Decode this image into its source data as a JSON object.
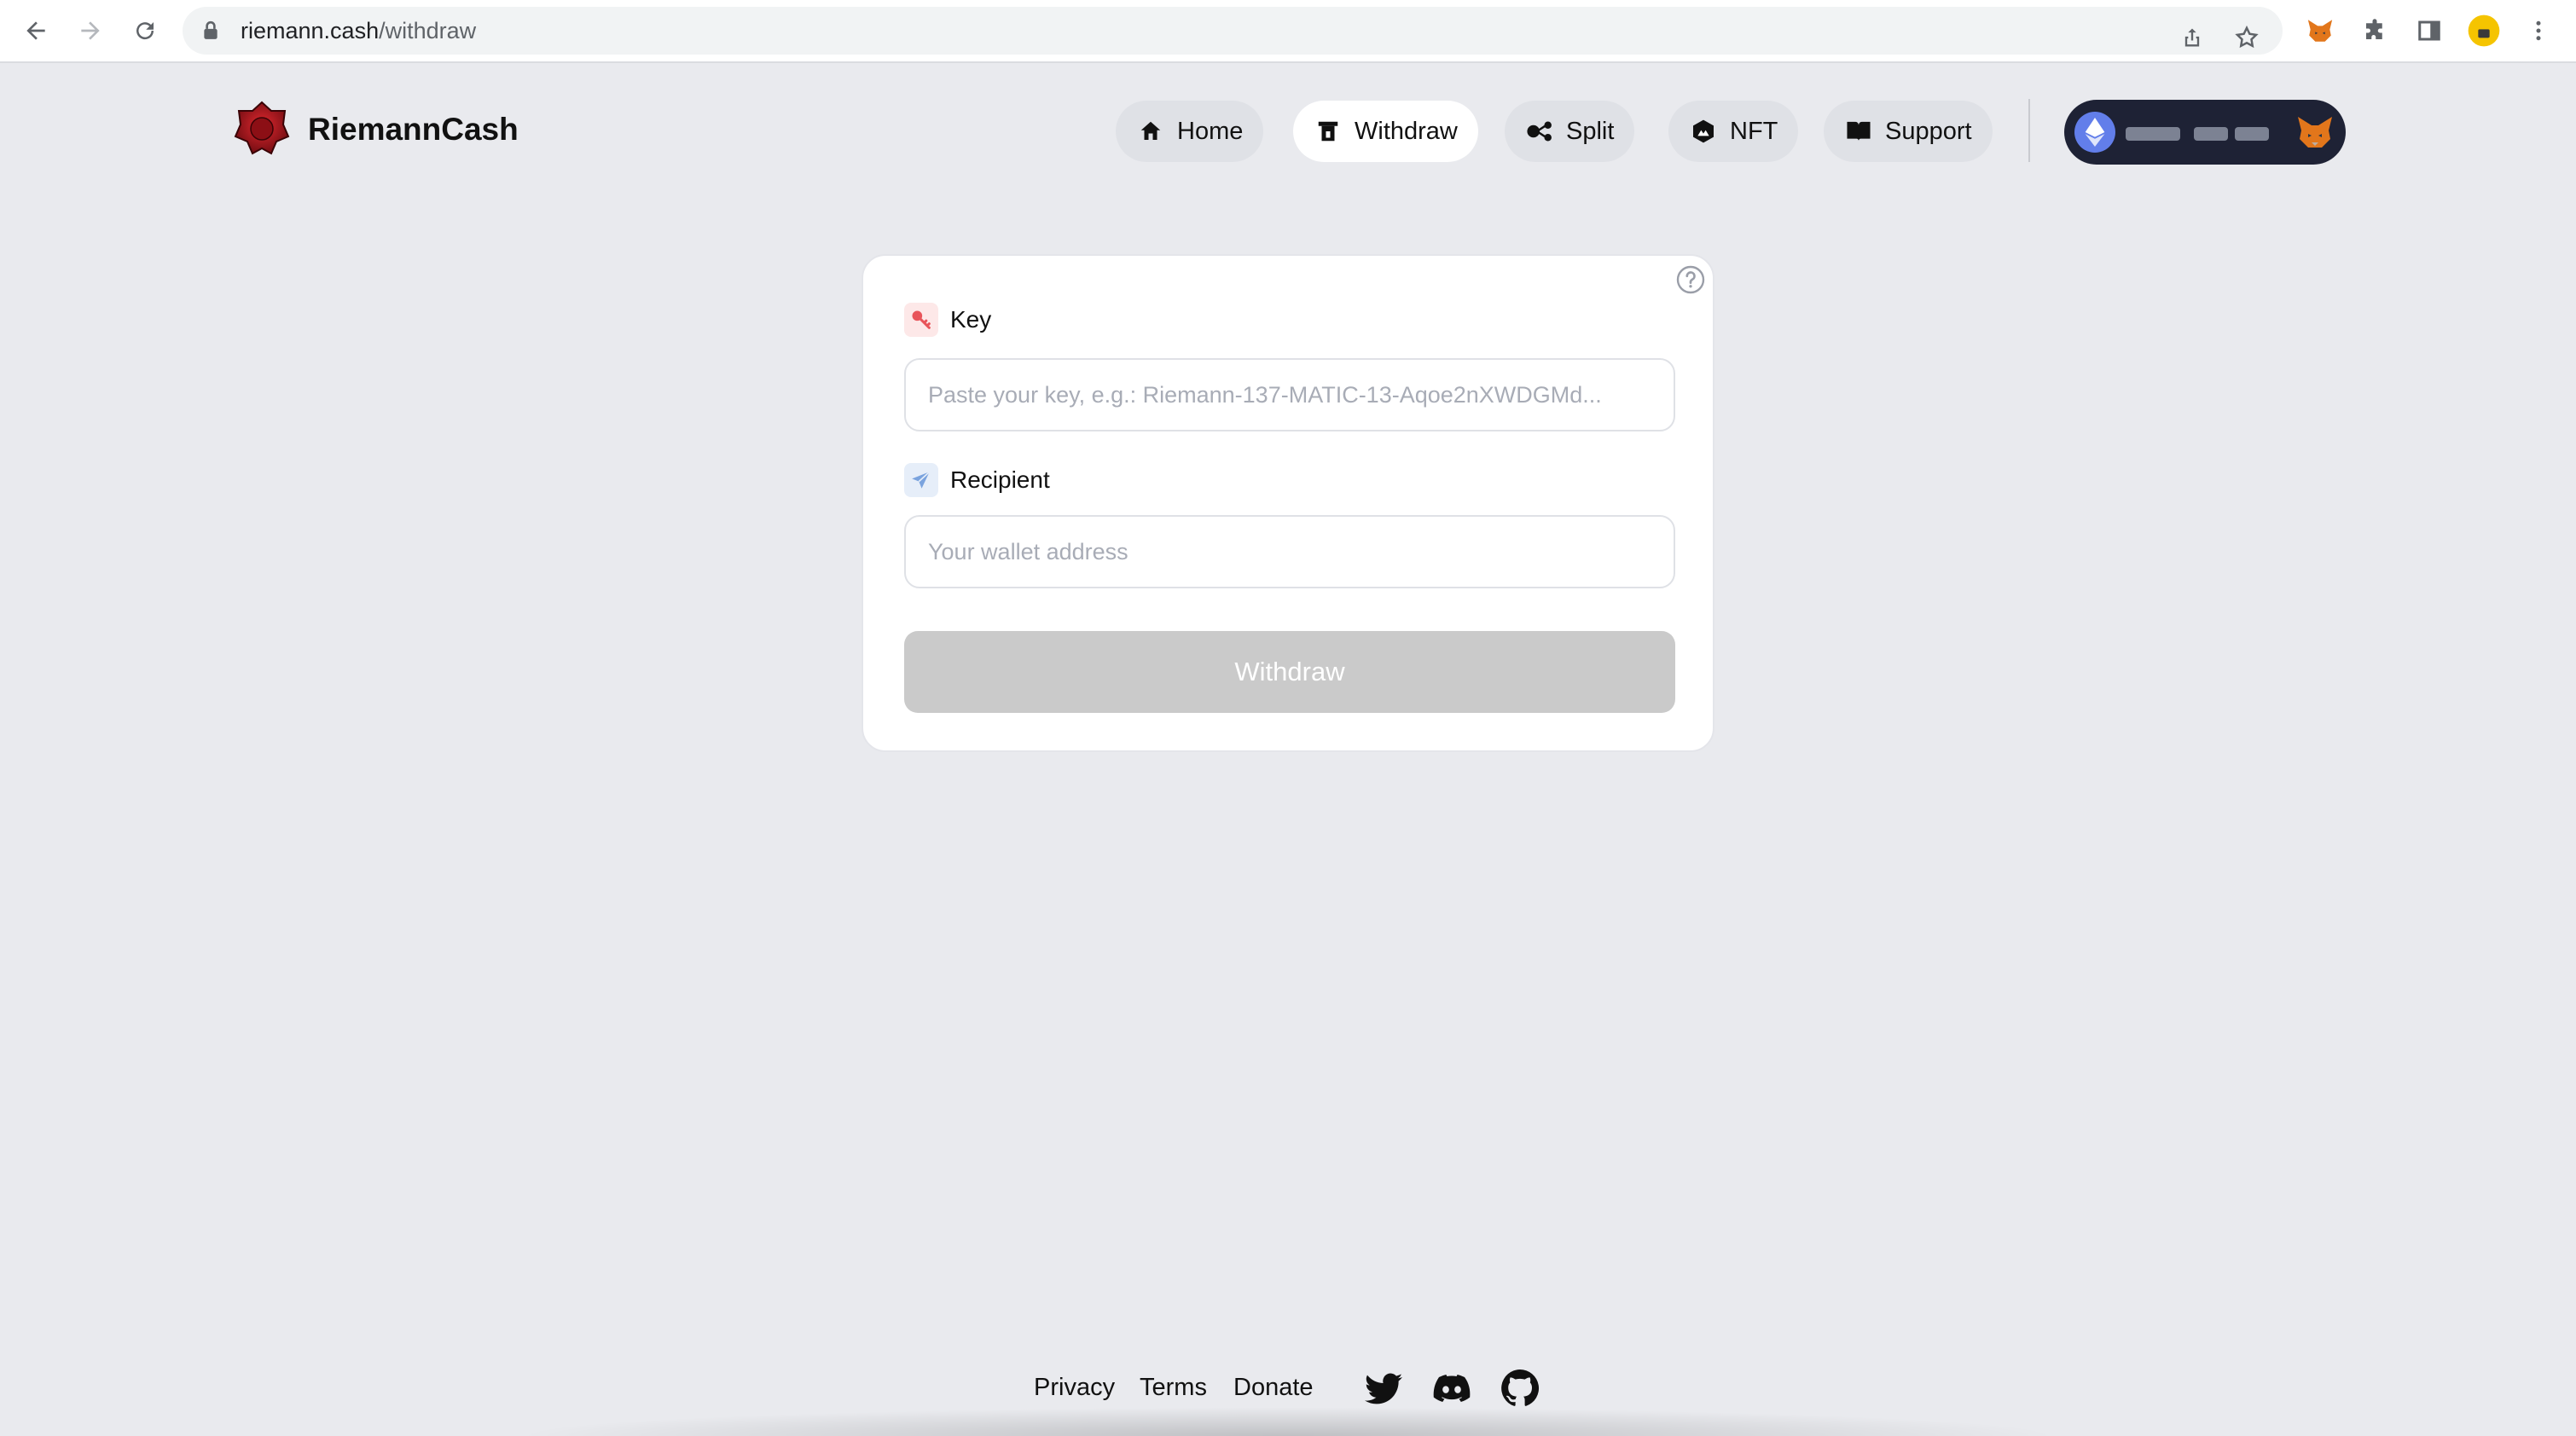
{
  "browser": {
    "url_host": "riemann.cash",
    "url_path": "/withdraw"
  },
  "header": {
    "brand": "RiemannCash",
    "nav": [
      {
        "label": "Home",
        "icon": "home-icon"
      },
      {
        "label": "Withdraw",
        "icon": "withdraw-icon",
        "active": true
      },
      {
        "label": "Split",
        "icon": "split-icon"
      },
      {
        "label": "NFT",
        "icon": "nft-icon"
      },
      {
        "label": "Support",
        "icon": "book-icon"
      }
    ],
    "wallet": {
      "network_icon": "ethereum-icon",
      "wallet_icon": "metamask-fox-icon"
    }
  },
  "form": {
    "key_label": "Key",
    "key_placeholder": "Paste your key, e.g.: Riemann-137-MATIC-13-Aqoe2nXWDGMd...",
    "recipient_label": "Recipient",
    "recipient_placeholder": "Your wallet address",
    "submit_label": "Withdraw"
  },
  "footer": {
    "links": [
      "Privacy",
      "Terms",
      "Donate"
    ],
    "social": [
      "twitter-icon",
      "discord-icon",
      "github-icon"
    ]
  },
  "colors": {
    "page_bg": "#e9eaee",
    "wallet_bg": "#1e2235",
    "button_disabled": "#cacaca",
    "brand_red": "#b0171f"
  }
}
